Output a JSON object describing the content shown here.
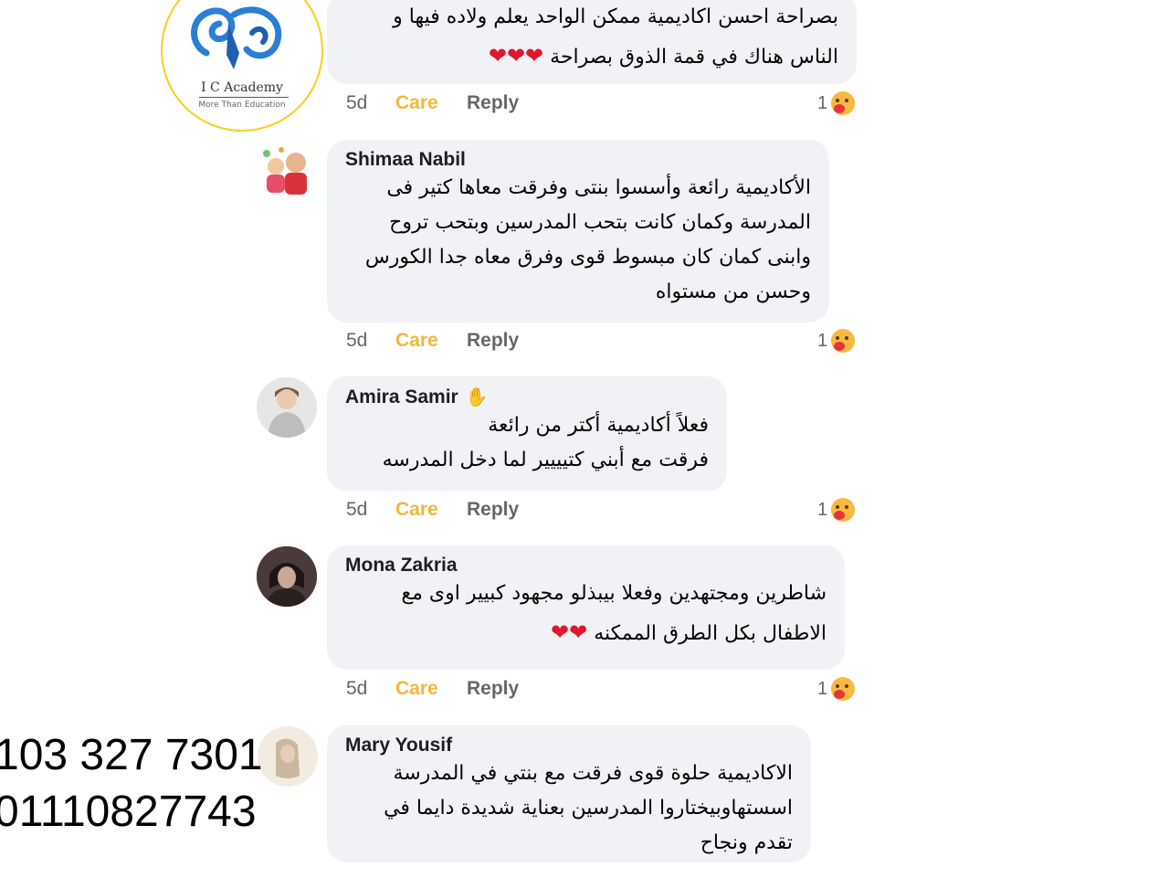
{
  "logo": {
    "name": "I C Academy",
    "tagline": "More Than Education"
  },
  "comments": [
    {
      "author": "",
      "lines": [
        "بصراحة احسن اكاديمية ممكن الواحد يعلم ولاده فيها و",
        "الناس هناك في قمة الذوق بصراحة"
      ],
      "hearts": "❤❤❤",
      "time": "5d",
      "care": "Care",
      "reply": "Reply",
      "reactions": "1"
    },
    {
      "author": "Shimaa Nabil",
      "lines": [
        "الأكاديمية رائعة وأسسوا بنتى وفرقت معاها كتير فى",
        "المدرسة وكمان كانت بتحب المدرسين وبتحب تروح",
        "وابنى كمان كان مبسوط قوى وفرق معاه جدا الكورس",
        "وحسن من مستواه"
      ],
      "time": "5d",
      "care": "Care",
      "reply": "Reply",
      "reactions": "1"
    },
    {
      "author": "Amira Samir",
      "lines": [
        "فعلاً أكاديمية أكتر من رائعة",
        "فرقت مع أبني كتيييير لما دخل المدرسه"
      ],
      "time": "5d",
      "care": "Care",
      "reply": "Reply",
      "reactions": "1"
    },
    {
      "author": "Mona Zakria",
      "lines": [
        "شاطرين ومجتهدين وفعلا بيبذلو مجهود كبيير اوى مع",
        "الاطفال بكل الطرق الممكنه"
      ],
      "hearts": "❤❤",
      "time": "5d",
      "care": "Care",
      "reply": "Reply",
      "reactions": "1"
    },
    {
      "author": "Mary Yousif",
      "lines": [
        "الاكاديمية حلوة قوى فرقت مع بنتي في المدرسة",
        "اسستهاوبيختاروا المدرسين بعناية شديدة دايما في",
        "تقدم ونجاح"
      ]
    }
  ],
  "phones": [
    "103 327 7301",
    "01110827743"
  ],
  "colors": {
    "bubble": "#f0f2f5",
    "care": "#f2b83f",
    "meta": "#65676b",
    "heart": "#e0162b",
    "logo_ring": "#f2d21b"
  }
}
